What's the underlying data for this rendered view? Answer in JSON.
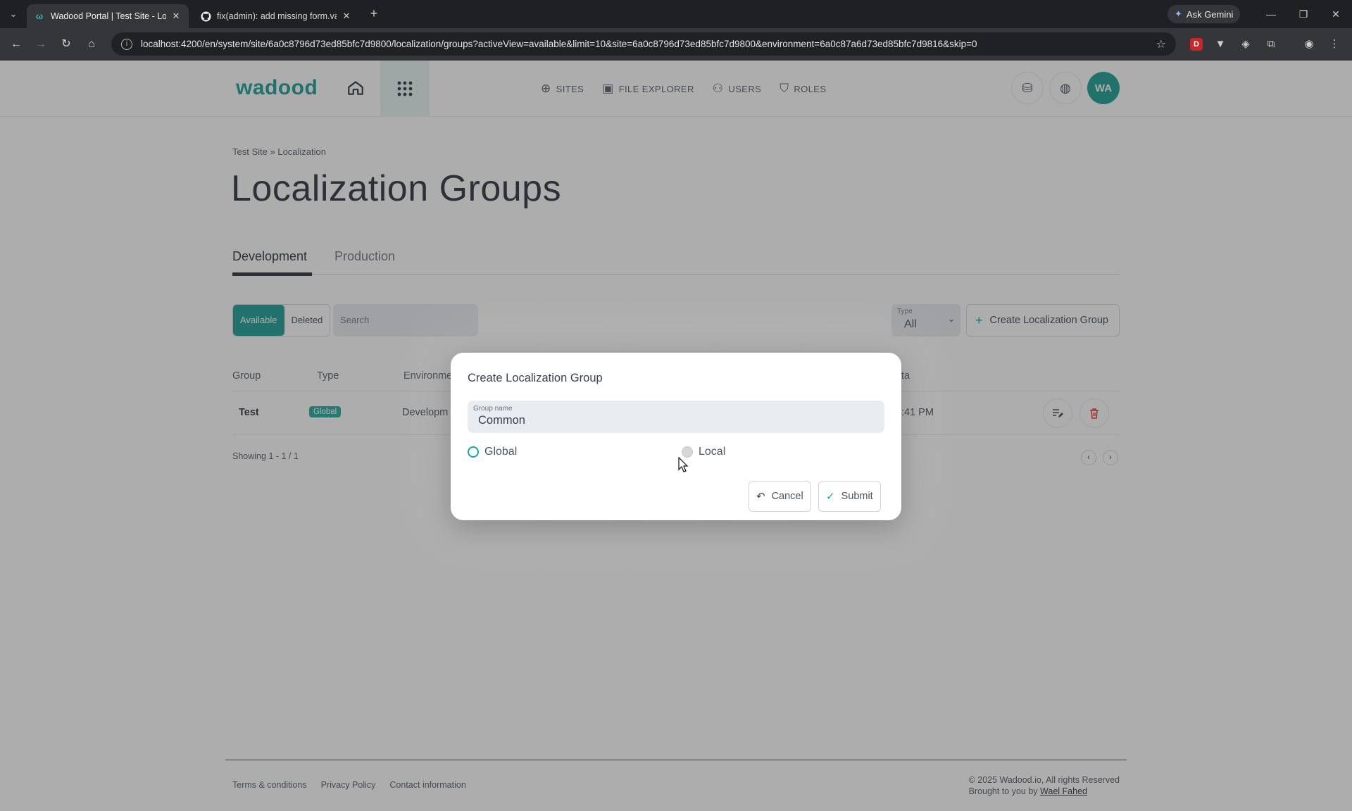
{
  "browser": {
    "tabs": [
      {
        "title": "Wadood Portal | Test Site - Loca",
        "active": true
      },
      {
        "title": "fix(admin): add missing form.va",
        "active": false
      }
    ],
    "gemini_label": "Ask Gemini",
    "url": "localhost:4200/en/system/site/6a0c8796d73ed85bfc7d9800/localization/groups?activeView=available&limit=10&site=6a0c8796d73ed85bfc7d9800&environment=6a0c87a6d73ed85bfc7d9816&skip=0"
  },
  "header": {
    "logo": "wadood",
    "nav": [
      {
        "label": "SITES",
        "icon": "globe-icon"
      },
      {
        "label": "FILE EXPLORER",
        "icon": "images-icon"
      },
      {
        "label": "USERS",
        "icon": "users-icon"
      },
      {
        "label": "ROLES",
        "icon": "shield-icon"
      }
    ],
    "avatar_initials": "WA"
  },
  "breadcrumb": {
    "site": "Test Site",
    "separator": "»",
    "section": "Localization"
  },
  "page_title": "Localization Groups",
  "env_tabs": [
    "Development",
    "Production"
  ],
  "toolbar": {
    "available": "Available",
    "deleted": "Deleted",
    "search_placeholder": "Search",
    "type_label": "Type",
    "type_value": "All",
    "create_label": "Create Localization Group"
  },
  "table": {
    "headers": {
      "group": "Group",
      "type": "Type",
      "environment": "Environme",
      "date": "ta"
    },
    "rows": [
      {
        "group": "Test",
        "type": "Global",
        "environment": "Developm",
        "date": ":41 PM"
      }
    ],
    "showing": "Showing 1 - 1 / 1"
  },
  "footer": {
    "links": [
      "Terms & conditions",
      "Privacy Policy",
      "Contact information"
    ],
    "copyright": "© 2025 Wadood.io, All rights Reserved",
    "brought_by": "Brought to you by",
    "author": "Wael Fahed"
  },
  "modal": {
    "title": "Create Localization Group",
    "field_label": "Group name",
    "field_value": "Common",
    "option_global": "Global",
    "option_local": "Local",
    "cancel": "Cancel",
    "submit": "Submit"
  },
  "colors": {
    "brand": "#0f9a92",
    "badge": "#19a79d"
  }
}
